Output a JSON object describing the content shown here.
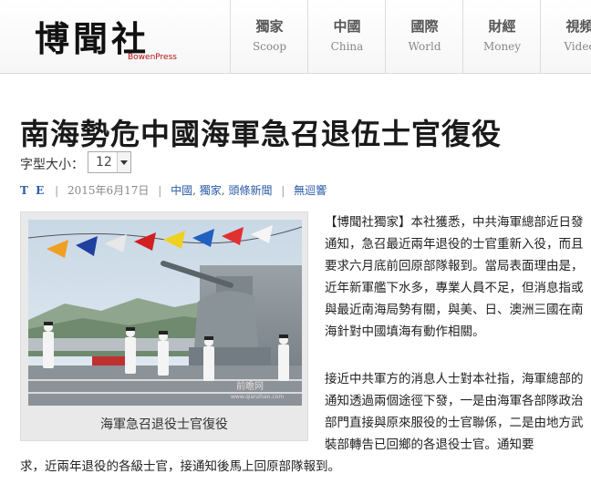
{
  "site": {
    "logo_cn": "博聞社",
    "logo_en": "BowenPress"
  },
  "nav": {
    "items": [
      {
        "cn": "獨家",
        "en": "Scoop"
      },
      {
        "cn": "中國",
        "en": "China"
      },
      {
        "cn": "國際",
        "en": "World"
      },
      {
        "cn": "財經",
        "en": "Money"
      },
      {
        "cn": "視頻",
        "en": "Video"
      }
    ]
  },
  "article": {
    "title": "南海勢危中國海軍急召退伍士官復役",
    "font_size_label": "字型大小：",
    "font_size_value": "12",
    "author": "T E",
    "date": "2015年6月17日",
    "categories": [
      "中國",
      "獨家",
      "頭條新聞"
    ],
    "comments": "無迴響",
    "photo_caption": "海軍急召退役士官復役",
    "photo_watermark": "前瞻网",
    "photo_watermark_url": "www.qianzhan.com",
    "para1": "【博聞社獨家】本社獲悉，中共海軍總部近日發通知，急召最近兩年退役的士官重新入役，而且要求六月底前回原部隊報到。當局表面理由是，近年新軍艦下水多，專業人員不足，但消息指或與最近南海局勢有關，與美、日、澳洲三國在南海針對中國填海有動作相關。",
    "para2": "接近中共軍方的消息人士對本社指，海軍總部的通知透過兩個途徑下發，一是由海軍各部隊政治部門直接與原來服役的士官聯係，二是由地方武裝部轉告已回鄉的各退役士官。通知要",
    "para2_tail": "求，近兩年退役的各級士官，接通知後馬上回原部隊報到。"
  },
  "colors": {
    "link": "#2a5ba8",
    "logo_en": "#b01010"
  }
}
